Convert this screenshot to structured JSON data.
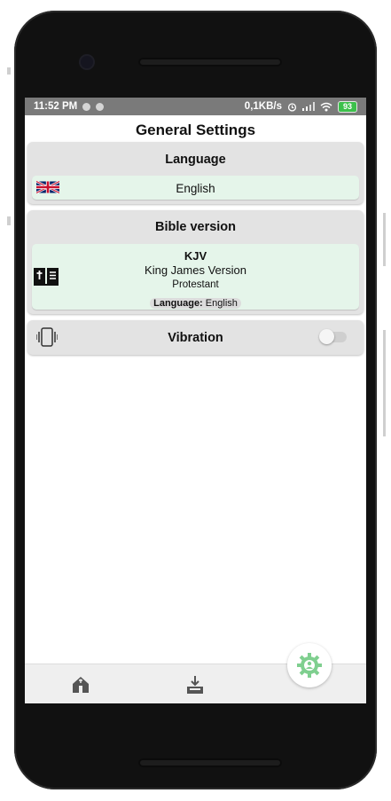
{
  "status_bar": {
    "time": "11:52 PM",
    "net_speed": "0,1KB/s",
    "battery": "93"
  },
  "page": {
    "title": "General Settings"
  },
  "language_card": {
    "title": "Language",
    "selected_language": "English",
    "flag_icon": "uk-flag-icon"
  },
  "bible_card": {
    "title": "Bible version",
    "abbr": "KJV",
    "name": "King James Version",
    "tradition": "Protestant",
    "language_label": "Language:",
    "language_value": "English",
    "icon": "bible-book-icon"
  },
  "vibration_card": {
    "label": "Vibration",
    "enabled": false,
    "icon": "vibrate-phone-icon"
  },
  "bottom_nav": {
    "items": [
      "church-home-icon",
      "download-tray-icon",
      "settings-gear-icon"
    ],
    "active_color": "#7fcf8f"
  },
  "colors": {
    "card_bg": "#e3e3e3",
    "row_bg": "#e5f5ea",
    "status_bar_bg": "#7a7a7a"
  }
}
